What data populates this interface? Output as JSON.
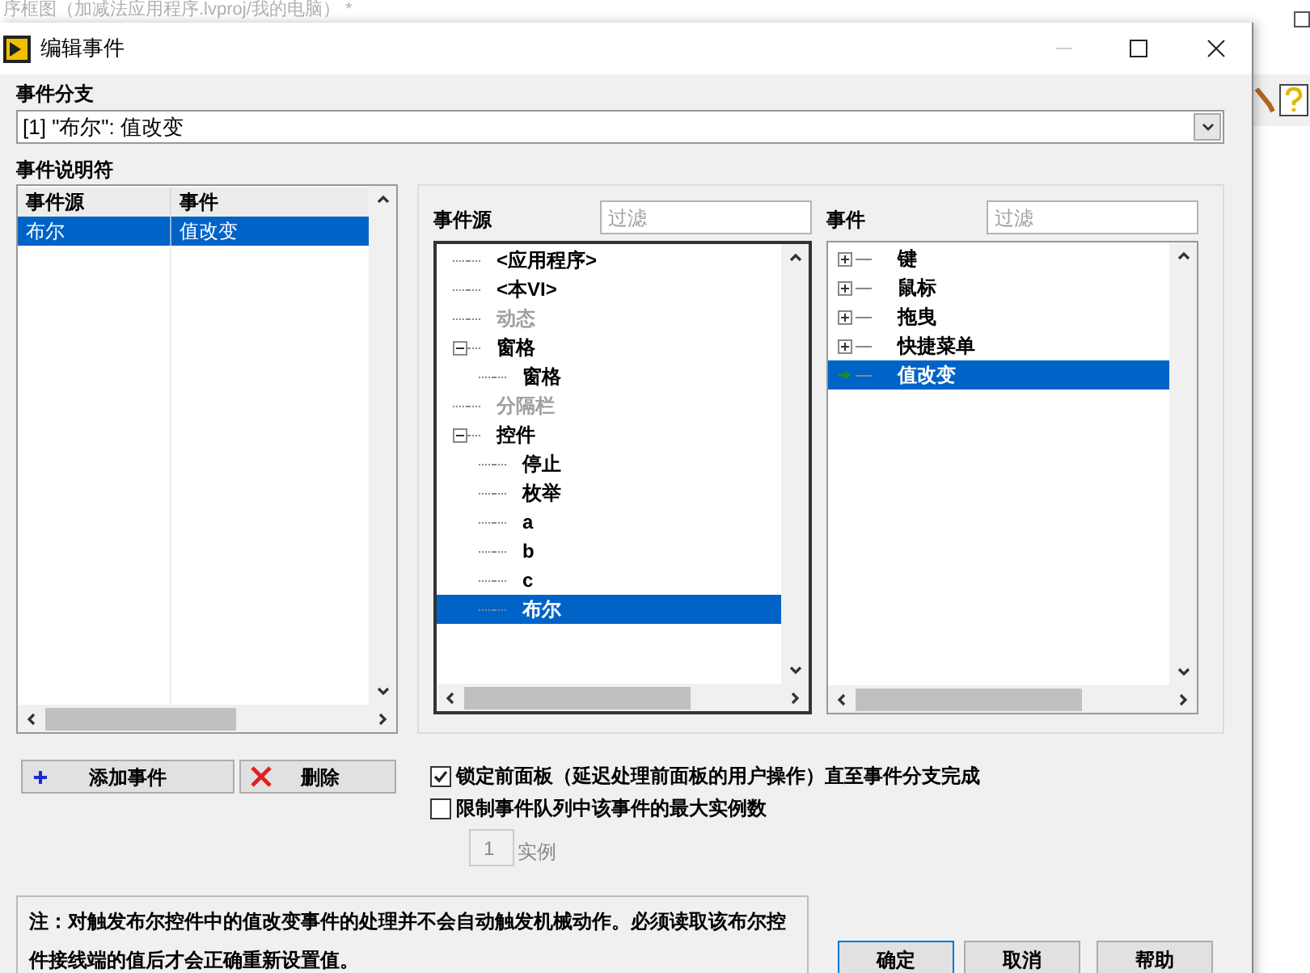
{
  "background_window": {
    "title": "序框图（加减法应用程序.lvproj/我的电脑） *"
  },
  "dialog": {
    "title": "编辑事件"
  },
  "event_case": {
    "label": "事件分支",
    "value": "[1] \"布尔\": 值改变"
  },
  "event_specifiers": {
    "label": "事件说明符",
    "columns": [
      "事件源",
      "事件"
    ],
    "rows": [
      {
        "source": "布尔",
        "event": "值改变",
        "selected": true
      }
    ]
  },
  "event_sources": {
    "label": "事件源",
    "filter_placeholder": "过滤",
    "tree": [
      {
        "label": "<应用程序>",
        "disabled": false,
        "selected": false
      },
      {
        "label": "<本VI>",
        "disabled": false,
        "selected": false
      },
      {
        "label": "动态",
        "disabled": true,
        "selected": false
      },
      {
        "label": "窗格",
        "disabled": false,
        "selected": false,
        "expanded": true,
        "children": [
          {
            "label": "窗格",
            "disabled": false,
            "selected": false
          }
        ]
      },
      {
        "label": "分隔栏",
        "disabled": true,
        "selected": false
      },
      {
        "label": "控件",
        "disabled": false,
        "selected": false,
        "expanded": true,
        "children": [
          {
            "label": "停止",
            "disabled": false,
            "selected": false
          },
          {
            "label": "枚举",
            "disabled": false,
            "selected": false
          },
          {
            "label": "a",
            "disabled": false,
            "selected": false
          },
          {
            "label": "b",
            "disabled": false,
            "selected": false
          },
          {
            "label": "c",
            "disabled": false,
            "selected": false
          },
          {
            "label": "布尔",
            "disabled": false,
            "selected": true
          }
        ]
      }
    ]
  },
  "events": {
    "label": "事件",
    "filter_placeholder": "过滤",
    "tree": [
      {
        "label": "键",
        "kind": "group",
        "expanded": false,
        "selected": false
      },
      {
        "label": "鼠标",
        "kind": "group",
        "expanded": false,
        "selected": false
      },
      {
        "label": "拖曳",
        "kind": "group",
        "expanded": false,
        "selected": false
      },
      {
        "label": "快捷菜单",
        "kind": "group",
        "expanded": false,
        "selected": false
      },
      {
        "label": "值改变",
        "kind": "event",
        "selected": true
      }
    ]
  },
  "buttons": [
    {
      "label": "添加事件",
      "kind": "add"
    },
    {
      "label": "删除",
      "kind": "delete"
    }
  ],
  "options": [
    {
      "label": "锁定前面板（延迟处理前面板的用户操作）直至事件分支完成",
      "checked": true
    },
    {
      "label": "限制事件队列中该事件的最大实例数",
      "checked": false
    }
  ],
  "instance_count": {
    "value": "1",
    "unit": "实例",
    "disabled": true
  },
  "note": "注：对触发布尔控件中的值改变事件的处理并不会自动触发机械动作。必须读取该布尔控件接线端的值后才会正确重新设置值。",
  "dialog_buttons": [
    "确定",
    "取消",
    "帮助"
  ]
}
